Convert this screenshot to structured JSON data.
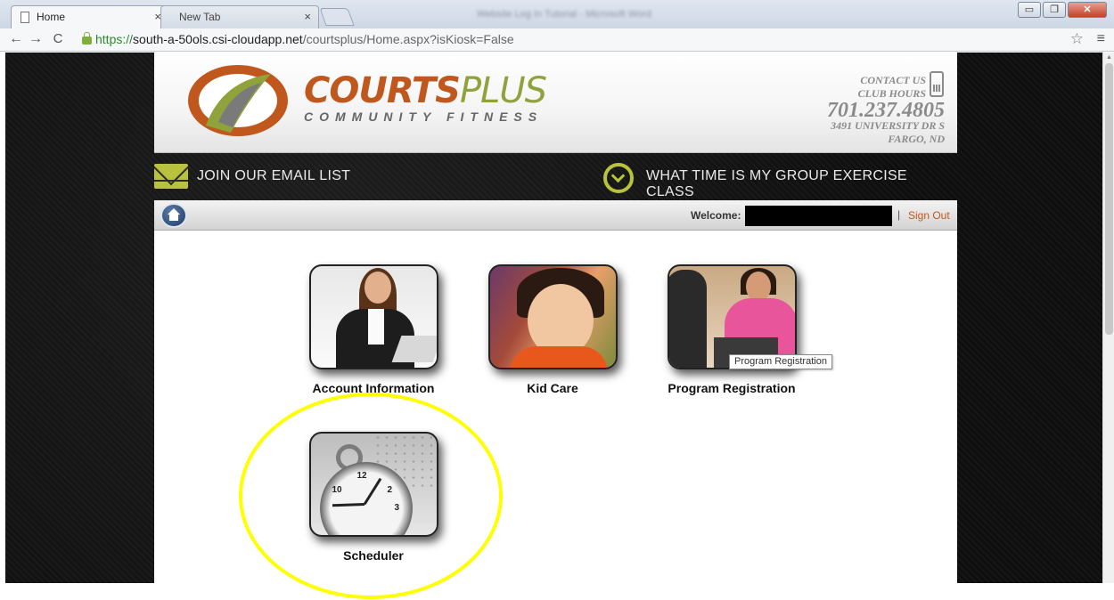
{
  "browser": {
    "tabs": [
      {
        "label": "Home",
        "active": true
      },
      {
        "label": "New Tab",
        "active": false
      }
    ],
    "window_title": "Website Log In Tutorial - Microsoft Word",
    "url": {
      "scheme": "https://",
      "host": "south-a-50ols.csi-cloudapp.net",
      "path": "/courtsplus/Home.aspx?isKiosk=False"
    },
    "close_glyph": "×",
    "icons": [
      "back-icon",
      "forward-icon",
      "reload-icon",
      "lock-icon",
      "star-icon",
      "menu-icon"
    ]
  },
  "header": {
    "logo_courts": "COURTS",
    "logo_plus": "PLUS",
    "logo_tagline": "COMMUNITY FITNESS",
    "contact_us": "CONTACT US",
    "club_hours": "CLUB HOURS",
    "phone": "701.237.4805",
    "address_line1": "3491 UNIVERSITY DR S",
    "address_line2": "FARGO, ND"
  },
  "info_strip": {
    "email_list": "JOIN OUR EMAIL LIST",
    "class_time": "WHAT TIME IS MY GROUP EXERCISE CLASS"
  },
  "welcome_bar": {
    "welcome_label": "Welcome:",
    "separator": "|",
    "sign_out": "Sign Out"
  },
  "tiles": [
    {
      "label": "Account Information"
    },
    {
      "label": "Kid Care"
    },
    {
      "label": "Program Registration"
    },
    {
      "label": "Scheduler"
    }
  ],
  "tooltip": "Program Registration",
  "colors": {
    "brand_orange": "#c0581d",
    "brand_green": "#b9c23d",
    "highlight": "#ffff00"
  }
}
